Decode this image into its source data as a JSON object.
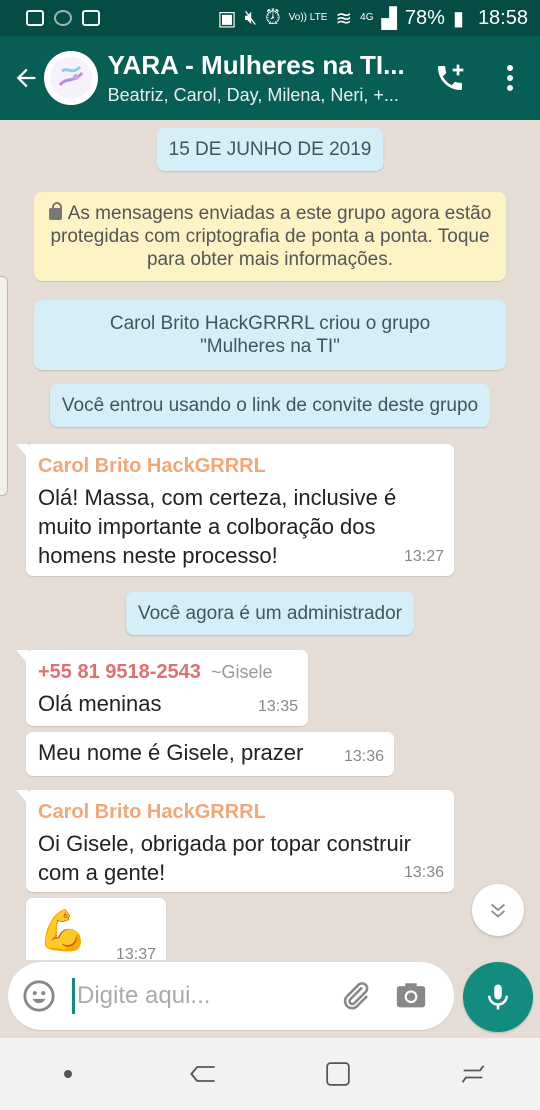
{
  "statusbar": {
    "lte_label": "Vo)) LTE",
    "network": "4G",
    "battery": "78%",
    "time": "18:58"
  },
  "header": {
    "title": "YARA - Mulheres na TI...",
    "subtitle": "Beatriz, Carol, Day, Milena, Neri, +..."
  },
  "chat": {
    "date_chip": "15 DE JUNHO DE 2019",
    "encryption_notice": "As mensagens enviadas a este grupo agora estão protegidas com criptografia de ponta a ponta. Toque para obter mais informações.",
    "group_created": "Carol Brito HackGRRRL criou o grupo \"Mulheres na TI\"",
    "joined_notice": "Você entrou usando o link de convite deste grupo",
    "admin_notice": "Você agora é um administrador",
    "messages": [
      {
        "sender": "Carol Brito HackGRRRL",
        "text": "Olá! Massa, com certeza, inclusive é muito importante a colboração dos homens neste processo!",
        "time": "13:27"
      },
      {
        "sender": "+55 81 9518-2543",
        "alias": "~Gisele",
        "text": "Olá meninas",
        "time": "13:35"
      },
      {
        "text": "Meu nome é Gisele, prazer",
        "time": "13:36"
      },
      {
        "sender": "Carol Brito HackGRRRL",
        "text": "Oi Gisele, obrigada por topar construir com a gente!",
        "time": "13:36"
      },
      {
        "text": "💪",
        "time": "13:37"
      }
    ]
  },
  "input": {
    "placeholder": "Digite aqui..."
  },
  "colors": {
    "header": "#075e54",
    "statusbar": "#054d44",
    "accent": "#128c7e",
    "chat_bg": "#e5ddd5",
    "sender_orange": "#f3a777",
    "sender_red": "#e26f6f"
  },
  "icons": {
    "back": "arrow-left-icon",
    "add_call": "add-call-icon",
    "menu": "more-vert-icon",
    "emoji": "emoji-icon",
    "attach": "paperclip-icon",
    "camera": "camera-icon",
    "mic": "microphone-icon",
    "scroll": "double-chevron-down-icon"
  }
}
